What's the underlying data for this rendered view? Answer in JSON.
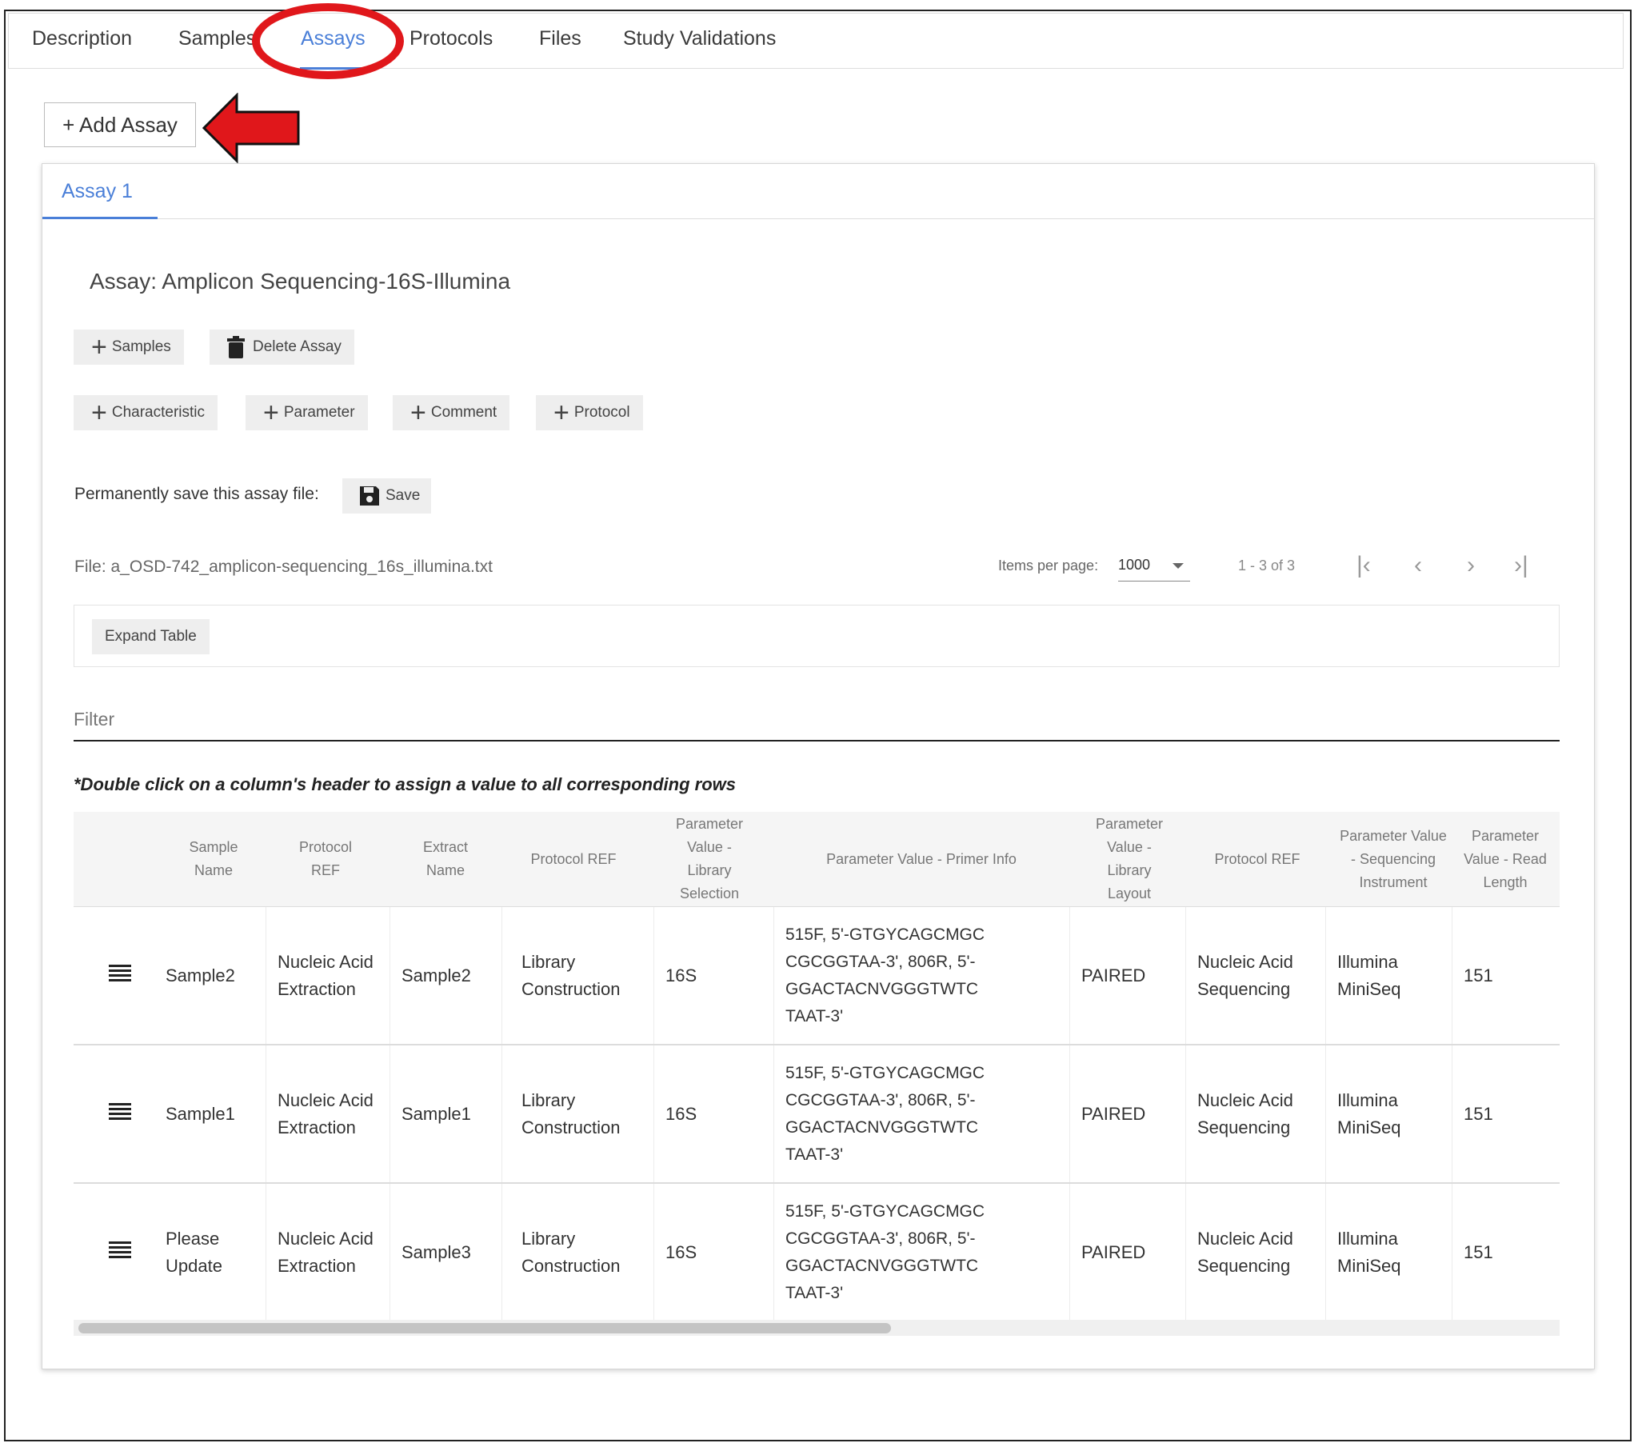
{
  "top_tabs": [
    "Description",
    "Samples",
    "Assays",
    "Protocols",
    "Files",
    "Study Validations"
  ],
  "active_tab": "Assays",
  "add_assay_label": "+ Add Assay",
  "assay_tab_label": "Assay 1",
  "assay_title": "Assay: Amplicon Sequencing-16S-Illumina",
  "buttons": {
    "samples": "Samples",
    "delete_assay": "Delete Assay",
    "characteristic": "Characteristic",
    "parameter": "Parameter",
    "comment": "Comment",
    "protocol": "Protocol",
    "save": "Save",
    "expand_table": "Expand Table"
  },
  "save_prompt": "Permanently save this assay file:",
  "file_label": "File: a_OSD-742_amplicon-sequencing_16s_illumina.txt",
  "pagination": {
    "items_per_page_label": "Items per page:",
    "items_per_page_value": "1000",
    "range": "1 - 3 of 3"
  },
  "filter_placeholder": "Filter",
  "hint": "*Double click on a column's header to assign a value to all corresponding rows",
  "table": {
    "headers": [
      "Sample Name",
      "Protocol REF",
      "Extract Name",
      "Protocol REF",
      "Parameter Value - Library Selection",
      "Parameter Value - Primer Info",
      "Parameter Value - Library Layout",
      "Protocol REF",
      "Parameter Value - Sequencing Instrument",
      "Parameter Value - Read Length"
    ],
    "rows": [
      [
        "Sample2",
        "Nucleic Acid Extraction",
        "Sample2",
        "Library Construction",
        "16S",
        "515F, 5'-GTGYCAGCMGCCGCGGTAA-3', 806R, 5'-GGACTACNVGGGTWTCTAAT-3'",
        "PAIRED",
        "Nucleic Acid Sequencing",
        "Illumina MiniSeq",
        "151"
      ],
      [
        "Sample1",
        "Nucleic Acid Extraction",
        "Sample1",
        "Library Construction",
        "16S",
        "515F, 5'-GTGYCAGCMGCCGCGGTAA-3', 806R, 5'-GGACTACNVGGGTWTCTAAT-3'",
        "PAIRED",
        "Nucleic Acid Sequencing",
        "Illumina MiniSeq",
        "151"
      ],
      [
        "Please Update",
        "Nucleic Acid Extraction",
        "Sample3",
        "Library Construction",
        "16S",
        "515F, 5'-GTGYCAGCMGCCGCGGTAA-3', 806R, 5'-GGACTACNVGGGTWTCTAAT-3'",
        "PAIRED",
        "Nucleic Acid Sequencing",
        "Illumina MiniSeq",
        "151"
      ]
    ]
  },
  "colors": {
    "accent": "#4a7fd8",
    "annotation_red": "#e0171b"
  }
}
